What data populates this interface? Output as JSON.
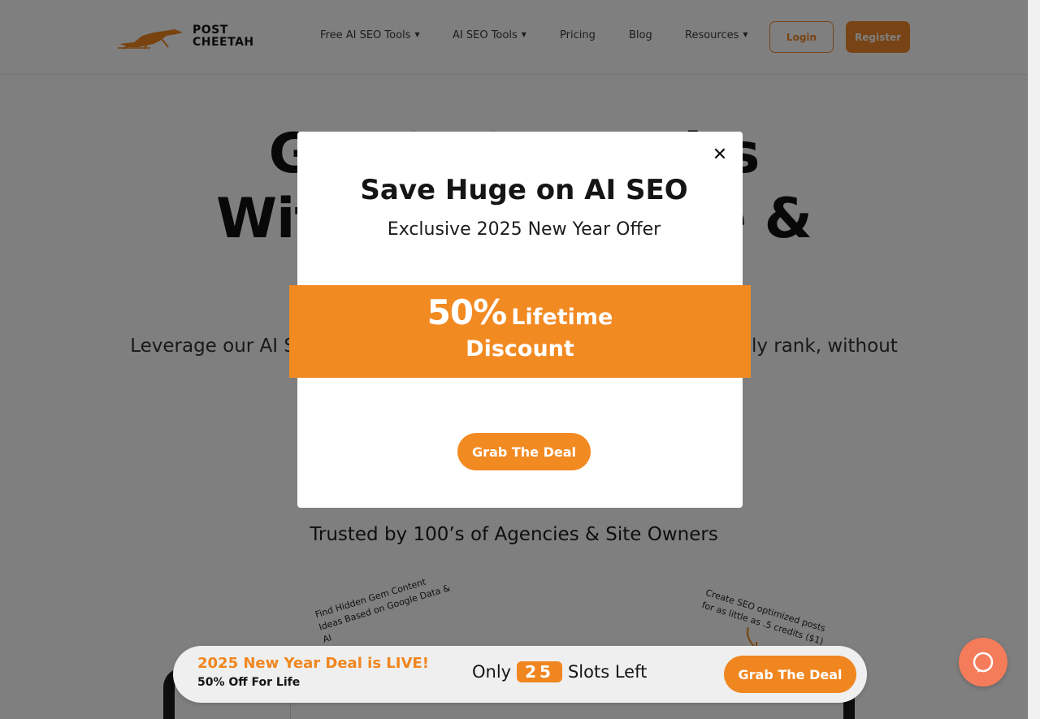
{
  "header": {
    "logo_text_line1": "POST",
    "logo_text_line2": "CHEETAH",
    "nav": [
      {
        "label": "Free AI SEO Tools",
        "dropdown": true
      },
      {
        "label": "AI SEO Tools",
        "dropdown": true
      },
      {
        "label": "Pricing",
        "dropdown": false
      },
      {
        "label": "Blog",
        "dropdown": false
      },
      {
        "label": "Resources",
        "dropdown": true
      }
    ],
    "login_label": "Login",
    "register_label": "Register"
  },
  "hero": {
    "title_line1": "Get SEO Results",
    "title_line2": "Without the Time &",
    "subtitle": "Leverage our AI SEO tools to build an SEO strategy that will actually rank, without the massive time",
    "trusted": "Trusted by 100’s of Agencies & Site Owners",
    "note_left": "Find Hidden Gem Content Ideas Based on Google Data & AI",
    "note_right": "Create SEO optimized posts for as little as .5 credits ($1)"
  },
  "modal": {
    "title": "Save Huge on AI SEO",
    "subtitle": "Exclusive 2025 New Year Offer",
    "promo_big": "50%",
    "promo_small": "Lifetime",
    "promo_line2": "Discount",
    "cta": "Grab The Deal",
    "close_icon": "close-icon"
  },
  "deal_bar": {
    "title": "2025 New Year Deal is LIVE!",
    "subtitle": "50% Off For Life",
    "slots_prefix": "Only",
    "slots_count": "25",
    "slots_suffix": "Slots Left",
    "cta": "Grab The Deal"
  },
  "colors": {
    "accent": "#f0861f",
    "overlay": "rgba(0,0,0,0.5)",
    "help": "#f47c5a"
  }
}
